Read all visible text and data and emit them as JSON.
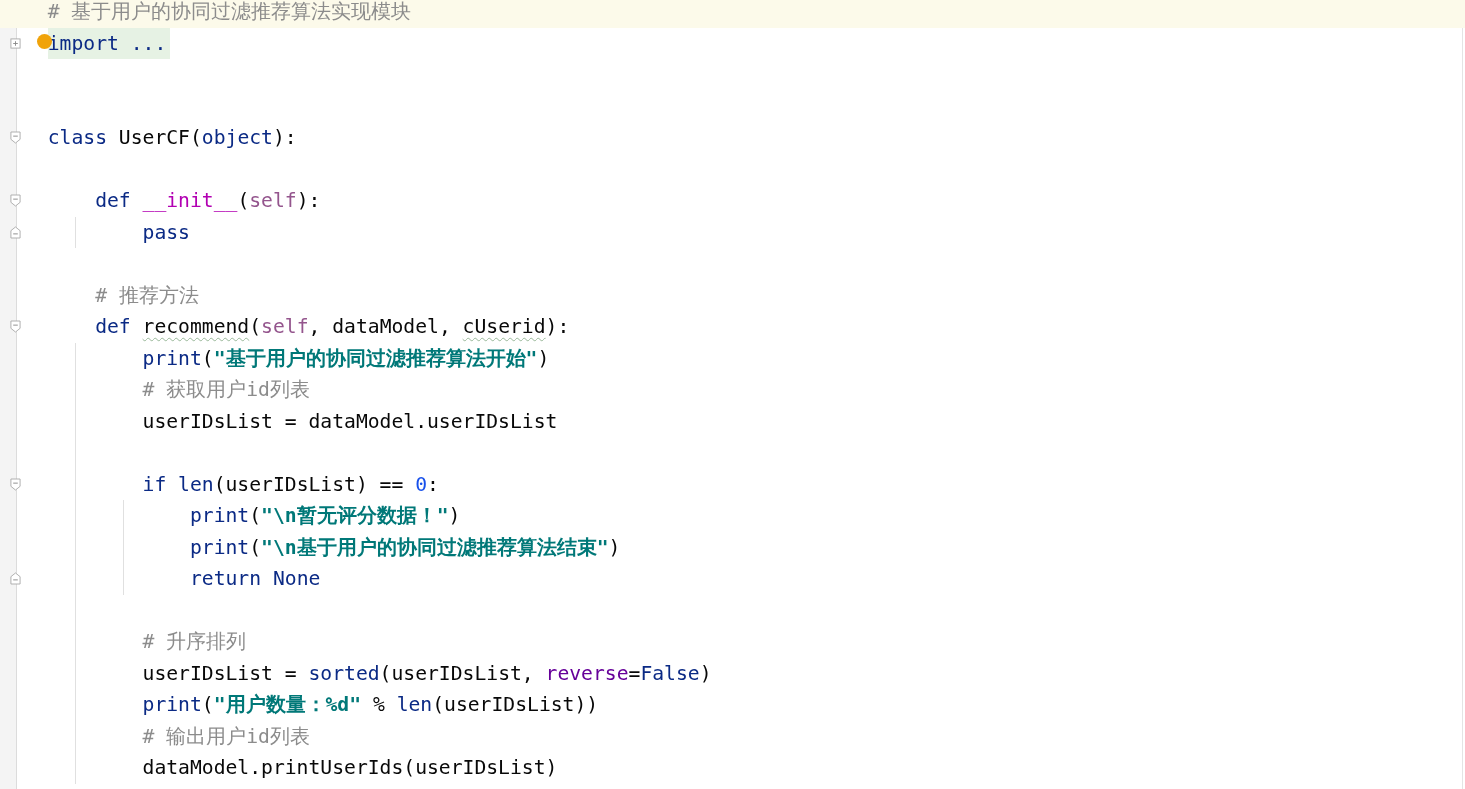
{
  "editor": {
    "lines": [
      {
        "kind": "code",
        "current": true,
        "tokens": [
          {
            "kind": "comment",
            "text": "# 基于用户的协同过滤推荐算法实现模块"
          }
        ]
      },
      {
        "kind": "code",
        "collapsed": true,
        "bulb": true,
        "tokens": [
          {
            "kind": "keyword",
            "text": "import ..."
          }
        ]
      },
      {
        "kind": "blank"
      },
      {
        "kind": "blank"
      },
      {
        "kind": "code",
        "foldable": true,
        "tokens": [
          {
            "kind": "keyword",
            "text": "class "
          },
          {
            "kind": "plain",
            "text": "UserCF("
          },
          {
            "kind": "builtin",
            "text": "object"
          },
          {
            "kind": "plain",
            "text": "):"
          }
        ],
        "children": [
          {
            "kind": "blank"
          },
          {
            "kind": "code",
            "foldable": true,
            "tokens": [
              {
                "kind": "keyword",
                "text": "def "
              },
              {
                "kind": "magic",
                "text": "__init__"
              },
              {
                "kind": "plain",
                "text": "("
              },
              {
                "kind": "self",
                "text": "self"
              },
              {
                "kind": "plain",
                "text": "):"
              }
            ],
            "children": [
              {
                "kind": "code",
                "block_end": true,
                "tokens": [
                  {
                    "kind": "keyword",
                    "text": "pass"
                  }
                ]
              }
            ]
          },
          {
            "kind": "blank"
          },
          {
            "kind": "code",
            "tokens": [
              {
                "kind": "comment",
                "text": "# 推荐方法"
              }
            ]
          },
          {
            "kind": "code",
            "foldable": true,
            "tokens": [
              {
                "kind": "keyword",
                "text": "def "
              },
              {
                "kind": "plain",
                "text": "recommend",
                "warning": true
              },
              {
                "kind": "plain",
                "text": "("
              },
              {
                "kind": "self",
                "text": "self"
              },
              {
                "kind": "plain",
                "text": ", dataModel, "
              },
              {
                "kind": "plain",
                "text": "cUserid",
                "warning": true
              },
              {
                "kind": "plain",
                "text": "):"
              }
            ],
            "children": [
              {
                "kind": "code",
                "tokens": [
                  {
                    "kind": "builtin",
                    "text": "print"
                  },
                  {
                    "kind": "plain",
                    "text": "("
                  },
                  {
                    "kind": "string",
                    "text": "\"基于用户的协同过滤推荐算法开始\""
                  },
                  {
                    "kind": "plain",
                    "text": ")"
                  }
                ]
              },
              {
                "kind": "code",
                "tokens": [
                  {
                    "kind": "comment",
                    "text": "# 获取用户id列表"
                  }
                ]
              },
              {
                "kind": "code",
                "tokens": [
                  {
                    "kind": "plain",
                    "text": "userIDsList = dataModel.userIDsList"
                  }
                ]
              },
              {
                "kind": "blank"
              },
              {
                "kind": "code",
                "foldable": true,
                "tokens": [
                  {
                    "kind": "keyword",
                    "text": "if "
                  },
                  {
                    "kind": "builtin",
                    "text": "len"
                  },
                  {
                    "kind": "plain",
                    "text": "(userIDsList) == "
                  },
                  {
                    "kind": "number",
                    "text": "0"
                  },
                  {
                    "kind": "plain",
                    "text": ":"
                  }
                ],
                "children": [
                  {
                    "kind": "code",
                    "tokens": [
                      {
                        "kind": "builtin",
                        "text": "print"
                      },
                      {
                        "kind": "plain",
                        "text": "("
                      },
                      {
                        "kind": "string",
                        "text": "\"\\n暂无评分数据！\""
                      },
                      {
                        "kind": "plain",
                        "text": ")"
                      }
                    ]
                  },
                  {
                    "kind": "code",
                    "tokens": [
                      {
                        "kind": "builtin",
                        "text": "print"
                      },
                      {
                        "kind": "plain",
                        "text": "("
                      },
                      {
                        "kind": "string",
                        "text": "\"\\n基于用户的协同过滤推荐算法结束\""
                      },
                      {
                        "kind": "plain",
                        "text": ")"
                      }
                    ]
                  },
                  {
                    "kind": "code",
                    "block_end": true,
                    "tokens": [
                      {
                        "kind": "keyword",
                        "text": "return None"
                      }
                    ]
                  }
                ]
              },
              {
                "kind": "blank"
              },
              {
                "kind": "code",
                "tokens": [
                  {
                    "kind": "comment",
                    "text": "# 升序排列"
                  }
                ]
              },
              {
                "kind": "code",
                "tokens": [
                  {
                    "kind": "plain",
                    "text": "userIDsList = "
                  },
                  {
                    "kind": "builtin",
                    "text": "sorted"
                  },
                  {
                    "kind": "plain",
                    "text": "(userIDsList, "
                  },
                  {
                    "kind": "param",
                    "text": "reverse"
                  },
                  {
                    "kind": "plain",
                    "text": "="
                  },
                  {
                    "kind": "keyword",
                    "text": "False"
                  },
                  {
                    "kind": "plain",
                    "text": ")"
                  }
                ]
              },
              {
                "kind": "code",
                "tokens": [
                  {
                    "kind": "builtin",
                    "text": "print"
                  },
                  {
                    "kind": "plain",
                    "text": "("
                  },
                  {
                    "kind": "string",
                    "text": "\"用户数量：%d\""
                  },
                  {
                    "kind": "plain",
                    "text": " % "
                  },
                  {
                    "kind": "builtin",
                    "text": "len"
                  },
                  {
                    "kind": "plain",
                    "text": "(userIDsList))"
                  }
                ]
              },
              {
                "kind": "code",
                "tokens": [
                  {
                    "kind": "comment",
                    "text": "# 输出用户id列表"
                  }
                ]
              },
              {
                "kind": "code",
                "tokens": [
                  {
                    "kind": "plain",
                    "text": "dataModel.printUserIds(userIDsList)"
                  }
                ]
              }
            ]
          }
        ]
      }
    ]
  }
}
